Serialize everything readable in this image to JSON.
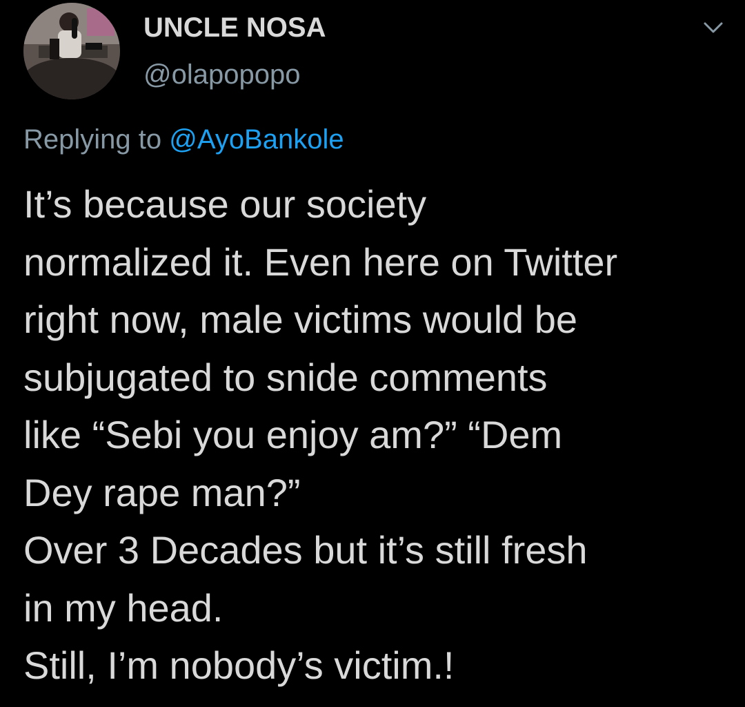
{
  "tweet": {
    "display_name": "UNCLE NOSA",
    "handle": "@olapopopo",
    "avatar_icon": "profile-photo-studio-microphone",
    "menu_icon": "chevron-down-icon",
    "replying_prefix": "Replying to",
    "replying_to": "@AyoBankole",
    "body_lines": [
      "It’s because our society",
      "normalized it. Even here on Twitter",
      "right now, male victims would be",
      "subjugated to snide comments",
      "like “Sebi you enjoy am?” “Dem",
      "Dey rape man?”",
      "Over 3 Decades but it’s still fresh",
      "in my head.",
      "Still, I’m nobody’s victim.!"
    ]
  },
  "colors": {
    "background": "#000000",
    "text": "#d9d9d9",
    "muted": "#8899a6",
    "link": "#1da1f2"
  }
}
